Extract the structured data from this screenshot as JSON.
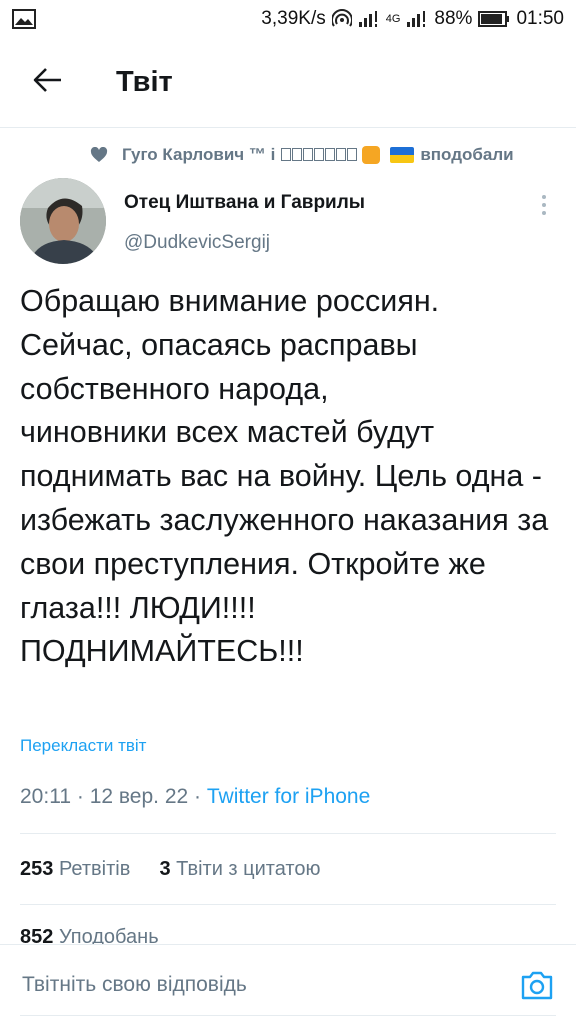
{
  "status_bar": {
    "speed": "3,39K/s",
    "network": "4G",
    "battery": "88%",
    "time": "01:50",
    "icons": [
      "image-icon",
      "hotspot-icon",
      "signal-icon",
      "signal-4g-icon",
      "battery-icon"
    ]
  },
  "header": {
    "title": "Твіт",
    "back_icon": "arrow-left-icon"
  },
  "social_context": {
    "name": "Гуго Карлович ™ і",
    "action": "вподобали",
    "icon": "heart-icon"
  },
  "tweet": {
    "author_name": "Отец Иштвана и Гаврилы",
    "author_handle": "@DudkevicSergij",
    "text": "Обращаю внимание россиян.\nСейчас, опасаясь расправы собственного народа,\nчиновники всех мастей будут поднимать вас на войну. Цель одна - избежать заслуженного наказания за свои преступления. Откройте же глаза!!! ЛЮДИ!!!!\nПОДНИМАЙТЕСЬ!!!",
    "translate_label": "Перекласти твіт",
    "time": "20:11",
    "date": "12 вер. 22",
    "separator": "·",
    "source": "Twitter for iPhone"
  },
  "stats": {
    "retweets_count": "253",
    "retweets_label": "Ретвітів",
    "quotes_count": "3",
    "quotes_label": "Твіти з цитатою",
    "likes_count": "852",
    "likes_label": "Уподобань"
  },
  "reply": {
    "placeholder": "Твітніть свою відповідь",
    "camera_icon": "camera-icon"
  },
  "colors": {
    "accent": "#1da1f2",
    "secondary_text": "#657786",
    "primary_text": "#14171a",
    "divider": "#e6ecf0"
  }
}
